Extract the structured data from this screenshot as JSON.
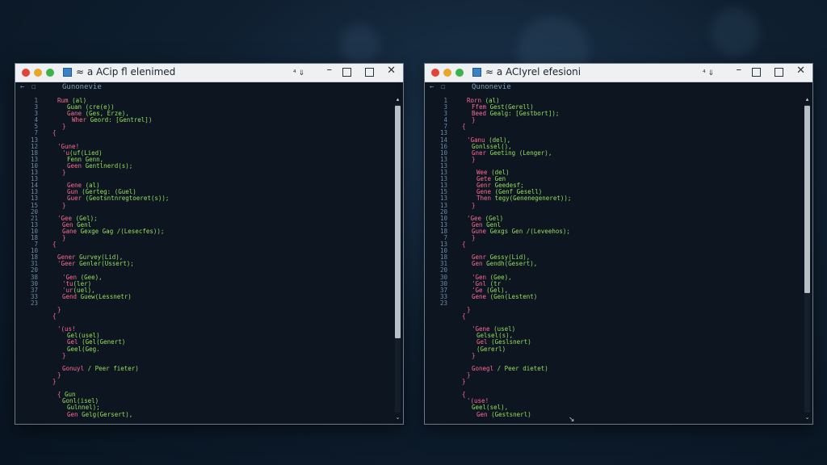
{
  "colors": {
    "keyword": "#ff6b91",
    "string": "#96e05d",
    "line_number": "#6e8ba3",
    "editor_bg": "#0c1520"
  },
  "windows": [
    {
      "title": "≈ a ACip ﬂ elenimed",
      "title_controls": {
        "extra": "⁴ ⇓",
        "minimize": "–",
        "close": "✕"
      },
      "toolbar": {
        "back_glyph": "←",
        "icon_glyph": "☐",
        "label": "Gunonevie"
      },
      "scroll": {
        "up": "▴",
        "down": "⌄"
      },
      "lines": [
        {
          "n": "1",
          "indent": 2,
          "kw": "Rum ",
          "str": "(al)"
        },
        {
          "n": "3",
          "indent": 4,
          "kw": "",
          "str": "Guan (cre(e))"
        },
        {
          "n": "3",
          "indent": 4,
          "kw": "Gane ",
          "str": "(Ges, Erze),"
        },
        {
          "n": "4",
          "indent": 5,
          "kw": "Wher ",
          "str": "Geord: [Gentrel])"
        },
        {
          "n": "5",
          "indent": 3,
          "kw": "}",
          "str": ""
        },
        {
          "n": "7",
          "indent": 1,
          "kw": "{",
          "str": ""
        },
        {
          "n": "13",
          "indent": 0,
          "kw": "",
          "str": ""
        },
        {
          "n": "12",
          "indent": 2,
          "kw": "'Gune!",
          "str": ""
        },
        {
          "n": "18",
          "indent": 3,
          "kw": "'u",
          "str": "(uf(Lied)"
        },
        {
          "n": "13",
          "indent": 4,
          "kw": "",
          "str": "Fenn Genn,"
        },
        {
          "n": "10",
          "indent": 4,
          "kw": "Geen ",
          "str": "Gentlnerd(s);"
        },
        {
          "n": "13",
          "indent": 3,
          "kw": "}",
          "str": ""
        },
        {
          "n": "13",
          "indent": 0,
          "kw": "",
          "str": ""
        },
        {
          "n": "14",
          "indent": 4,
          "kw": "Gene ",
          "str": "(al)"
        },
        {
          "n": "13",
          "indent": 4,
          "kw": "Gun ",
          "str": "(Gerteg: (Guel)"
        },
        {
          "n": "13",
          "indent": 4,
          "kw": "Guer ",
          "str": "(Geotsntnregtoeret(s));"
        },
        {
          "n": "15",
          "indent": 3,
          "kw": "}",
          "str": ""
        },
        {
          "n": "20",
          "indent": 0,
          "kw": "",
          "str": ""
        },
        {
          "n": "21",
          "indent": 2,
          "kw": "'Gee ",
          "str": "(Gel);"
        },
        {
          "n": "13",
          "indent": 3,
          "kw": "Gen ",
          "str": "Genl"
        },
        {
          "n": "10",
          "indent": 3,
          "kw": "Gane ",
          "str": "Gexge Gag /(Lesecfes));"
        },
        {
          "n": "18",
          "indent": 3,
          "kw": "}",
          "str": ""
        },
        {
          "n": "7",
          "indent": 1,
          "kw": "{",
          "str": ""
        },
        {
          "n": "10",
          "indent": 0,
          "kw": "",
          "str": ""
        },
        {
          "n": "18",
          "indent": 2,
          "kw": "Gener ",
          "str": "Gurvey(Lid),"
        },
        {
          "n": "31",
          "indent": 2,
          "kw": "'Geer ",
          "str": "Genler(Ussert);"
        },
        {
          "n": "20",
          "indent": 0,
          "kw": "",
          "str": ""
        },
        {
          "n": "38",
          "indent": 3,
          "kw": "'Gen ",
          "str": "(Gee),"
        },
        {
          "n": "30",
          "indent": 3,
          "kw": "'tu",
          "str": "(ler)"
        },
        {
          "n": "37",
          "indent": 3,
          "kw": "'ur",
          "str": "(uel),"
        },
        {
          "n": "33",
          "indent": 3,
          "kw": "Gend ",
          "str": "Guew(Lessnetr)"
        },
        {
          "n": "23",
          "indent": 0,
          "kw": "",
          "str": ""
        },
        {
          "n": "",
          "indent": 2,
          "kw": "}",
          "str": ""
        },
        {
          "n": "",
          "indent": 1,
          "kw": "{",
          "str": ""
        },
        {
          "n": "",
          "indent": 0,
          "kw": "",
          "str": ""
        },
        {
          "n": "",
          "indent": 2,
          "kw": "'(us!",
          "str": ""
        },
        {
          "n": "",
          "indent": 4,
          "kw": "",
          "str": "Gel(usel)"
        },
        {
          "n": "",
          "indent": 4,
          "kw": "Gel ",
          "str": "(Gel(Genert)"
        },
        {
          "n": "",
          "indent": 4,
          "kw": "",
          "str": "Geel(Geg."
        },
        {
          "n": "",
          "indent": 3,
          "kw": "}",
          "str": ""
        },
        {
          "n": "",
          "indent": 0,
          "kw": "",
          "str": ""
        },
        {
          "n": "",
          "indent": 3,
          "kw": "Gonuyl ",
          "str": "/ Peer fieter)"
        },
        {
          "n": "",
          "indent": 2,
          "kw": "}",
          "str": ""
        },
        {
          "n": "",
          "indent": 1,
          "kw": "}",
          "str": ""
        },
        {
          "n": "",
          "indent": 0,
          "kw": "",
          "str": ""
        },
        {
          "n": "",
          "indent": 2,
          "kw": "{ ",
          "str": "Gun"
        },
        {
          "n": "",
          "indent": 3,
          "kw": "",
          "str": "Gonl(isel)"
        },
        {
          "n": "",
          "indent": 4,
          "kw": "",
          "str": "Gulnnel);"
        },
        {
          "n": "",
          "indent": 4,
          "kw": "Gen ",
          "str": "Gelg(Gersert),"
        }
      ]
    },
    {
      "title": "≈ a ACIyrel efesioni",
      "title_controls": {
        "extra": "⁴ ⇓",
        "minimize": "–",
        "close": "✕"
      },
      "toolbar": {
        "back_glyph": "←",
        "icon_glyph": "☐",
        "label": "Qunonevie"
      },
      "scroll": {
        "up": "▴",
        "down": "⌄"
      },
      "lines": [
        {
          "n": "1",
          "indent": 2,
          "kw": "Rorn ",
          "str": "(al)"
        },
        {
          "n": "3",
          "indent": 3,
          "kw": "Ffem ",
          "str": "Gest(Gerell)"
        },
        {
          "n": "3",
          "indent": 3,
          "kw": "Beed ",
          "str": "Gealg: [Gestbort]);"
        },
        {
          "n": "4",
          "indent": 3,
          "kw": "}",
          "str": ""
        },
        {
          "n": "7",
          "indent": 1,
          "kw": "{",
          "str": ""
        },
        {
          "n": "13",
          "indent": 0,
          "kw": "",
          "str": ""
        },
        {
          "n": "14",
          "indent": 2,
          "kw": "'Ganu ",
          "str": "(del),"
        },
        {
          "n": "16",
          "indent": 3,
          "kw": "",
          "str": "Gonlssel(),"
        },
        {
          "n": "10",
          "indent": 3,
          "kw": "Gner ",
          "str": "Geeting (Lenger),"
        },
        {
          "n": "13",
          "indent": 3,
          "kw": "}",
          "str": ""
        },
        {
          "n": "13",
          "indent": 0,
          "kw": "",
          "str": ""
        },
        {
          "n": "13",
          "indent": 4,
          "kw": "Wee ",
          "str": "(del)"
        },
        {
          "n": "13",
          "indent": 4,
          "kw": "Gete ",
          "str": "Gen"
        },
        {
          "n": "13",
          "indent": 4,
          "kw": "Genr ",
          "str": "Geedesf;"
        },
        {
          "n": "15",
          "indent": 4,
          "kw": "Gene ",
          "str": "(Genf Gesell)"
        },
        {
          "n": "13",
          "indent": 4,
          "kw": "Then ",
          "str": "tegy(Genenegeneret));"
        },
        {
          "n": "13",
          "indent": 3,
          "kw": "}",
          "str": ""
        },
        {
          "n": "20",
          "indent": 0,
          "kw": "",
          "str": ""
        },
        {
          "n": "10",
          "indent": 2,
          "kw": "'Gee ",
          "str": "(Gel)"
        },
        {
          "n": "13",
          "indent": 3,
          "kw": "Gen ",
          "str": "Genl"
        },
        {
          "n": "18",
          "indent": 3,
          "kw": "Gune ",
          "str": "Gexgs Gen /(Leveehos);"
        },
        {
          "n": "7",
          "indent": 3,
          "kw": "}",
          "str": ""
        },
        {
          "n": "13",
          "indent": 1,
          "kw": "{",
          "str": ""
        },
        {
          "n": "10",
          "indent": 0,
          "kw": "",
          "str": ""
        },
        {
          "n": "18",
          "indent": 3,
          "kw": "Genr ",
          "str": "Gessy(Lid),"
        },
        {
          "n": "31",
          "indent": 3,
          "kw": "Gen ",
          "str": "Gendh(Gesert),"
        },
        {
          "n": "20",
          "indent": 0,
          "kw": "",
          "str": ""
        },
        {
          "n": "30",
          "indent": 3,
          "kw": "'Gen ",
          "str": "(Gee),"
        },
        {
          "n": "30",
          "indent": 3,
          "kw": "'Gnl ",
          "str": "(tr"
        },
        {
          "n": "37",
          "indent": 3,
          "kw": "'Ge ",
          "str": "(Gel),"
        },
        {
          "n": "33",
          "indent": 3,
          "kw": "Gene ",
          "str": "(Gen(Lestent)"
        },
        {
          "n": "23",
          "indent": 0,
          "kw": "",
          "str": ""
        },
        {
          "n": "",
          "indent": 2,
          "kw": "}",
          "str": ""
        },
        {
          "n": "",
          "indent": 1,
          "kw": "{",
          "str": ""
        },
        {
          "n": "",
          "indent": 0,
          "kw": "",
          "str": ""
        },
        {
          "n": "",
          "indent": 3,
          "kw": "'Gene ",
          "str": "(usel)"
        },
        {
          "n": "",
          "indent": 4,
          "kw": "",
          "str": "Gelsel(s),"
        },
        {
          "n": "",
          "indent": 4,
          "kw": "Gel ",
          "str": "(Geslsnert)"
        },
        {
          "n": "",
          "indent": 4,
          "kw": "",
          "str": "(Gererl)"
        },
        {
          "n": "",
          "indent": 3,
          "kw": "}",
          "str": ""
        },
        {
          "n": "",
          "indent": 0,
          "kw": "",
          "str": ""
        },
        {
          "n": "",
          "indent": 3,
          "kw": "Gonegl ",
          "str": "/ Peer dietet)"
        },
        {
          "n": "",
          "indent": 2,
          "kw": "}",
          "str": ""
        },
        {
          "n": "",
          "indent": 1,
          "kw": "}",
          "str": ""
        },
        {
          "n": "",
          "indent": 0,
          "kw": "",
          "str": ""
        },
        {
          "n": "",
          "indent": 1,
          "kw": "{ ",
          "str": ""
        },
        {
          "n": "",
          "indent": 2,
          "kw": "'(use!",
          "str": ""
        },
        {
          "n": "",
          "indent": 3,
          "kw": "",
          "str": "Geel(sel),"
        },
        {
          "n": "",
          "indent": 4,
          "kw": "Gen ",
          "str": "(Gestsnerl)"
        }
      ]
    }
  ]
}
